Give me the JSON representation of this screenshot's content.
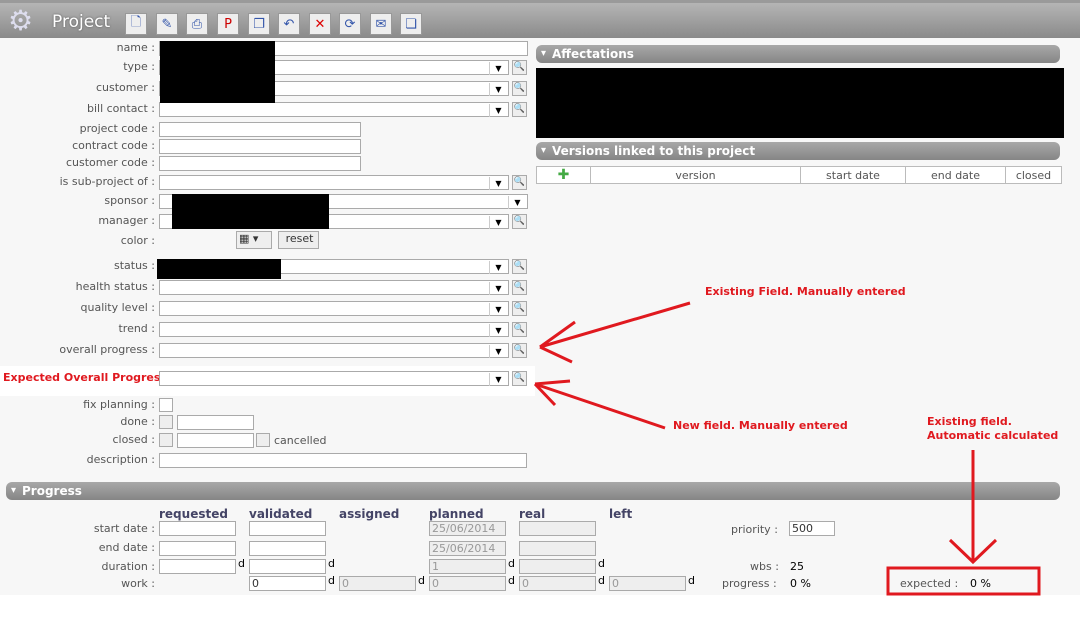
{
  "header": {
    "title": "Project",
    "toolbar": [
      {
        "name": "new",
        "glyph": "🗋"
      },
      {
        "name": "save",
        "glyph": "✎"
      },
      {
        "name": "print",
        "glyph": "⎙"
      },
      {
        "name": "pdf",
        "glyph": "P"
      },
      {
        "name": "copy",
        "glyph": "❐"
      },
      {
        "name": "undo",
        "glyph": "↶"
      },
      {
        "name": "delete",
        "glyph": "✕"
      },
      {
        "name": "refresh",
        "glyph": "⟳"
      },
      {
        "name": "email",
        "glyph": "✉"
      },
      {
        "name": "multi-save",
        "glyph": "❏"
      }
    ]
  },
  "form": {
    "name": "name :",
    "type": "type :",
    "customer": "customer :",
    "bill_contact": "bill contact :",
    "project_code": "project code :",
    "contract_code": "contract code :",
    "customer_code": "customer code :",
    "sub_project": "is sub-project of :",
    "sponsor": "sponsor :",
    "manager": "manager :",
    "color": "color :",
    "reset": "reset",
    "status": "status :",
    "health": "health status :",
    "quality": "quality level :",
    "trend": "trend :",
    "overall": "overall progress :",
    "expected_overall": "Expected Overall Progress:",
    "fix_planning": "fix planning :",
    "done": "done :",
    "closed": "closed :",
    "cancelled": "cancelled",
    "description": "description :"
  },
  "affectations": {
    "title": "Affectations"
  },
  "versions": {
    "title": "Versions linked to this project",
    "columns": [
      "version",
      "start date",
      "end date",
      "closed"
    ]
  },
  "progress": {
    "title": "Progress",
    "columns": [
      "requested",
      "validated",
      "assigned",
      "planned",
      "real",
      "left"
    ],
    "rows": {
      "start": "start date :",
      "end": "end date :",
      "duration": "duration :",
      "work": "work :"
    },
    "planned_start": "25/06/2014",
    "planned_end": "25/06/2014",
    "planned_duration": "1",
    "work_values": [
      "0",
      "0",
      "0",
      "0",
      "0"
    ],
    "unit": "d",
    "priority_label": "priority :",
    "priority": "500",
    "wbs_label": "wbs :",
    "wbs": "25",
    "progress_label": "progress :",
    "progress": "0 %",
    "expected_label": "expected :",
    "expected": "0 %"
  },
  "annotations": {
    "existing": "Existing Field. Manually entered",
    "new": "New field. Manually entered",
    "auto1": "Existing field.",
    "auto2": "Automatic calculated"
  }
}
